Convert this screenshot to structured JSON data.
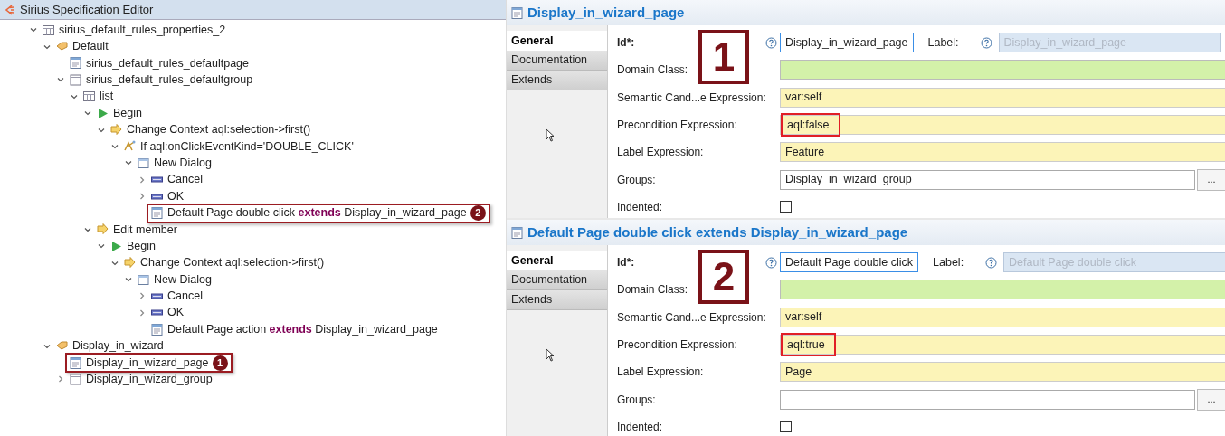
{
  "editor": {
    "title": "Sirius Specification Editor",
    "tree": [
      {
        "label": "sirius_default_rules_properties_2",
        "kind": "table",
        "expanded": true,
        "children": [
          {
            "label": "Default",
            "kind": "category",
            "expanded": true,
            "children": [
              {
                "label": "sirius_default_rules_defaultpage",
                "kind": "page"
              },
              {
                "label": "sirius_default_rules_defaultgroup",
                "kind": "group",
                "expanded": true,
                "children": [
                  {
                    "label": "list",
                    "kind": "table",
                    "expanded": true,
                    "children": [
                      {
                        "label": "Begin",
                        "kind": "begin",
                        "expanded": true,
                        "children": [
                          {
                            "label": "Change Context aql:selection->first()",
                            "kind": "context",
                            "expanded": true,
                            "children": [
                              {
                                "label": "If aql:onClickEventKind='DOUBLE_CLICK'",
                                "kind": "if",
                                "expanded": true,
                                "children": [
                                  {
                                    "label": "New Dialog",
                                    "kind": "dialog",
                                    "expanded": true,
                                    "children": [
                                      {
                                        "label": "Cancel",
                                        "kind": "button",
                                        "expanded": false
                                      },
                                      {
                                        "label": "OK",
                                        "kind": "button",
                                        "expanded": false
                                      },
                                      {
                                        "label": "Default Page double click **extends** Display_in_wizard_page",
                                        "kind": "page",
                                        "callout": "2"
                                      }
                                    ]
                                  }
                                ]
                              }
                            ]
                          }
                        ]
                      },
                      {
                        "label": "Edit member",
                        "kind": "context",
                        "expanded": true,
                        "children": [
                          {
                            "label": "Begin",
                            "kind": "begin",
                            "expanded": true,
                            "children": [
                              {
                                "label": "Change Context aql:selection->first()",
                                "kind": "context",
                                "expanded": true,
                                "children": [
                                  {
                                    "label": "New Dialog",
                                    "kind": "dialog",
                                    "expanded": true,
                                    "children": [
                                      {
                                        "label": "Cancel",
                                        "kind": "button",
                                        "expanded": false
                                      },
                                      {
                                        "label": "OK",
                                        "kind": "button",
                                        "expanded": false
                                      },
                                      {
                                        "label": "Default Page action **extends** Display_in_wizard_page",
                                        "kind": "page"
                                      }
                                    ]
                                  }
                                ]
                              }
                            ]
                          }
                        ]
                      }
                    ]
                  }
                ]
              }
            ]
          },
          {
            "label": "Display_in_wizard",
            "kind": "category",
            "expanded": true,
            "children": [
              {
                "label": "Display_in_wizard_page",
                "kind": "page",
                "callout": "1"
              },
              {
                "label": "Display_in_wizard_group",
                "kind": "group",
                "expanded": false
              }
            ]
          }
        ]
      }
    ]
  },
  "panels": [
    {
      "title": "Display_in_wizard_page",
      "marker": "1",
      "tabs": [
        {
          "label": "General",
          "selected": true
        },
        {
          "label": "Documentation",
          "selected": false
        },
        {
          "label": "Extends",
          "selected": false
        }
      ],
      "fields": [
        {
          "kind": "id",
          "label": "Id*:",
          "value": "Display_in_wizard_page",
          "label2": "Label:",
          "value2": "Display_in_wizard_page"
        },
        {
          "kind": "class",
          "label": "Domain Class:"
        },
        {
          "kind": "expression",
          "label": "Semantic Cand...e Expression:",
          "value": "var:self",
          "highlighted": false
        },
        {
          "kind": "expression",
          "label": "Precondition Expression:",
          "value": "aql:false",
          "highlighted": true
        },
        {
          "kind": "expression",
          "label": "Label Expression:",
          "value": "Feature",
          "highlighted": false
        },
        {
          "kind": "reference",
          "label": "Groups:",
          "value": "Display_in_wizard_group",
          "button": "..."
        },
        {
          "kind": "checkbox",
          "label": "Indented:",
          "checked": false
        }
      ]
    },
    {
      "title": "Default Page double click extends Display_in_wizard_page",
      "marker": "2",
      "tabs": [
        {
          "label": "General",
          "selected": true
        },
        {
          "label": "Documentation",
          "selected": false
        },
        {
          "label": "Extends",
          "selected": false
        }
      ],
      "fields": [
        {
          "kind": "id",
          "label": "Id*:",
          "value": "Default Page double click",
          "label2": "Label:",
          "value2": "Default Page double click"
        },
        {
          "kind": "class",
          "label": "Domain Class:"
        },
        {
          "kind": "expression",
          "label": "Semantic Cand...e Expression:",
          "value": "var:self",
          "highlighted": false
        },
        {
          "kind": "expression",
          "label": "Precondition Expression:",
          "value": "aql:true",
          "highlighted": true
        },
        {
          "kind": "expression",
          "label": "Label Expression:",
          "value": "Page",
          "highlighted": false
        },
        {
          "kind": "reference",
          "label": "Groups:",
          "button": "..."
        },
        {
          "kind": "checkbox",
          "label": "Indented:",
          "checked": false
        }
      ]
    }
  ]
}
